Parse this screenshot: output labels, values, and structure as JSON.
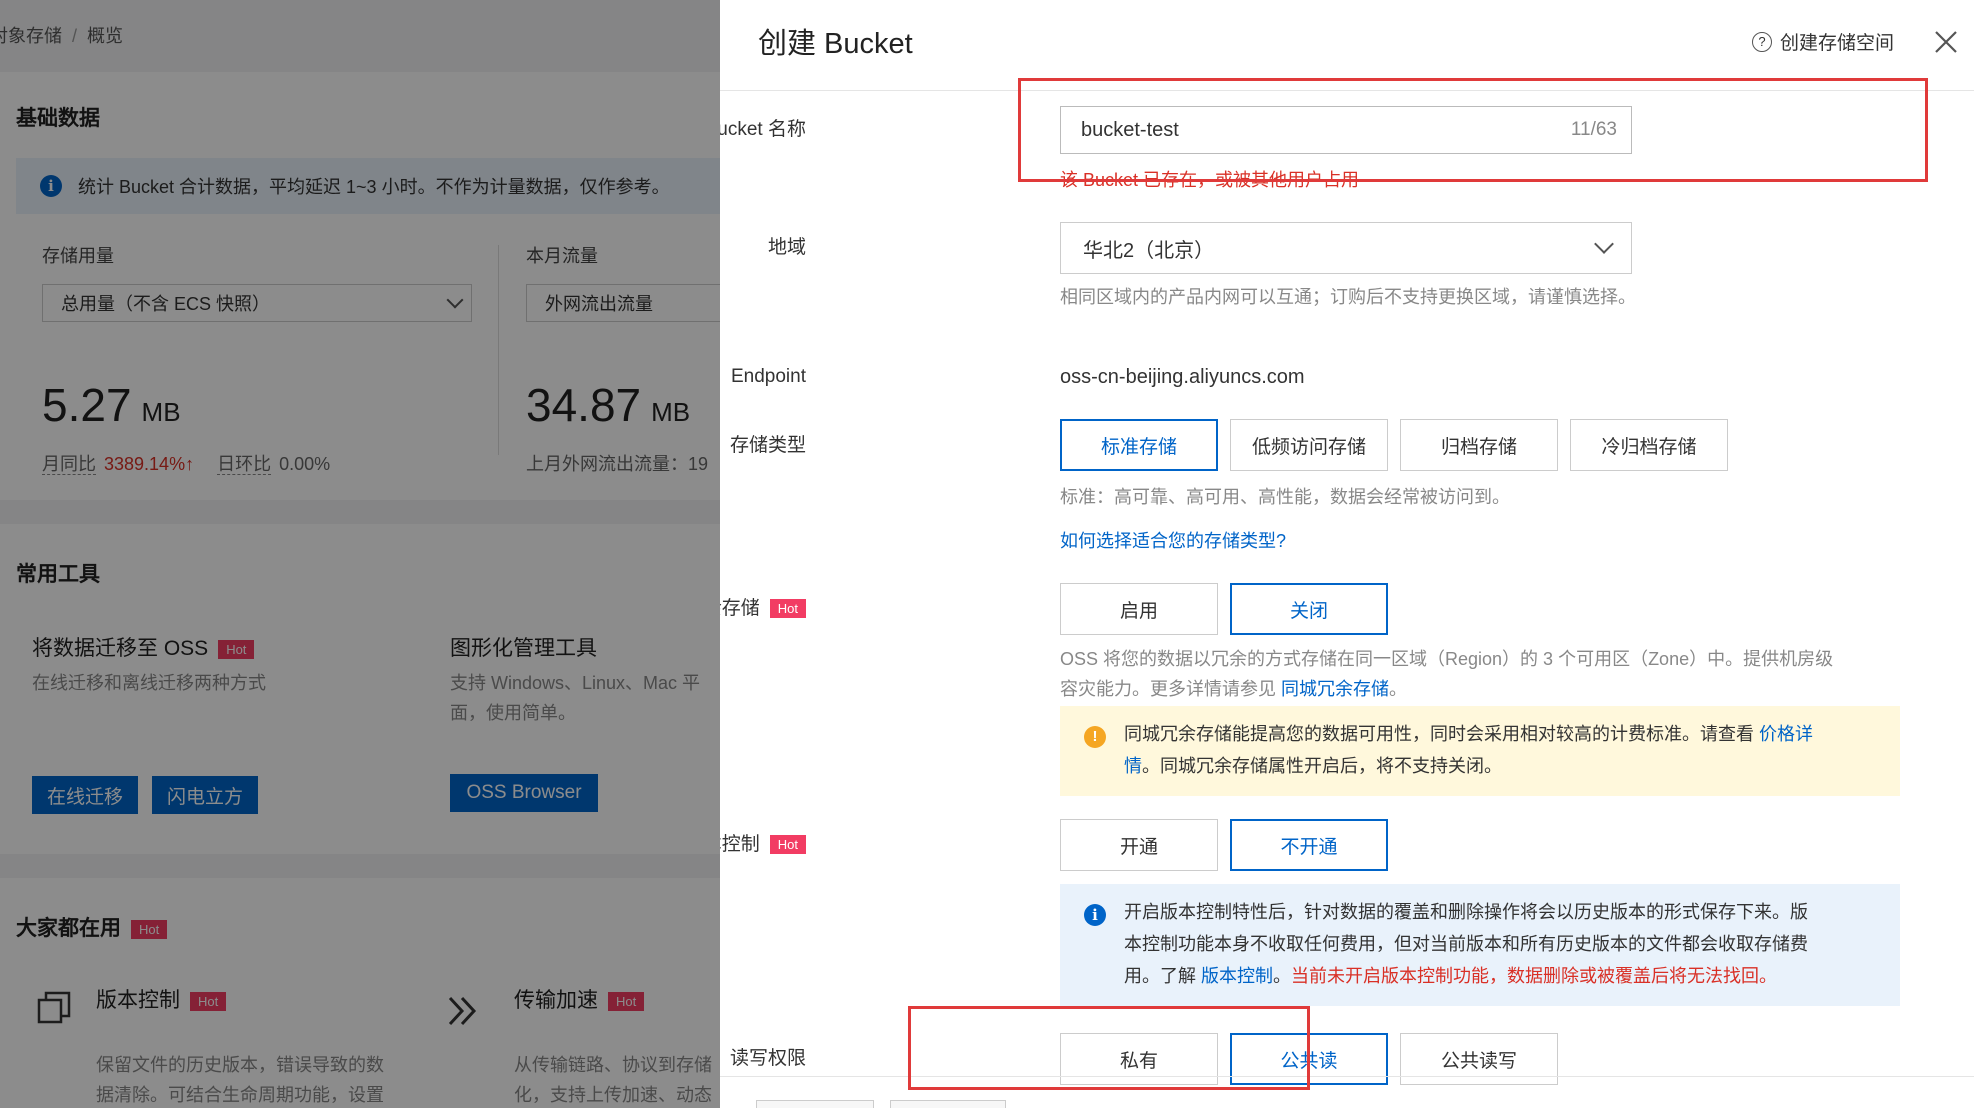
{
  "left": {
    "breadcrumb": [
      "对象存储",
      "概览"
    ],
    "basic": {
      "title": "基础数据",
      "info": "统计 Bucket 合计数据，平均延迟 1~3 小时。不作为计量数据，仅作参考。",
      "storage": {
        "label": "存储用量",
        "select": "总用量（不含 ECS 快照）",
        "value": "5.27",
        "unit": "MB",
        "mom_label": "月同比",
        "mom_value": "3389.14%↑",
        "dod_label": "日环比",
        "dod_value": "0.00%"
      },
      "traffic": {
        "label": "本月流量",
        "select": "外网流出流量",
        "value": "34.87",
        "unit": "MB",
        "last_month": "上月外网流出流量：19"
      }
    },
    "tools": {
      "title": "常用工具",
      "hot": "Hot",
      "migrate": {
        "title": "将数据迁移至 OSS",
        "desc": "在线迁移和离线迁移两种方式",
        "btn_online": "在线迁移",
        "btn_cube": "闪电立方"
      },
      "gui": {
        "title": "图形化管理工具",
        "desc1": "支持 Windows、Linux、Mac 平",
        "desc2": "面，使用简单。",
        "btn": "OSS Browser"
      }
    },
    "popular": {
      "title": "大家都在用",
      "hot": "Hot",
      "versioning": {
        "title": "版本控制",
        "desc1": "保留文件的历史版本，错误导致的数",
        "desc2": "据清除。可结合生命周期功能，设置"
      },
      "accel": {
        "title": "传输加速",
        "desc1": "从传输链路、协议到存储",
        "desc2": "化，支持上传加速、动态"
      }
    }
  },
  "drawer": {
    "title": "创建 Bucket",
    "help": "创建存储空间",
    "name": {
      "label": "Bucket 名称",
      "value": "bucket-test",
      "counter": "11/63",
      "error": "该 Bucket 已存在，或被其他用户占用"
    },
    "region": {
      "label": "地域",
      "value": "华北2（北京）",
      "hint": "相同区域内的产品内网可以互通；订购后不支持更换区域，请谨慎选择。"
    },
    "endpoint": {
      "label": "Endpoint",
      "value": "oss-cn-beijing.aliyuncs.com"
    },
    "storage_class": {
      "label": "存储类型",
      "options": [
        "标准存储",
        "低频访问存储",
        "归档存储",
        "冷归档存储"
      ],
      "selected": "标准存储",
      "hint": "标准：高可靠、高可用、高性能，数据会经常被访问到。",
      "link": "如何选择适合您的存储类型?"
    },
    "zrs": {
      "label": "同城冗余存储",
      "hot": "Hot",
      "options": [
        "启用",
        "关闭"
      ],
      "selected": "关闭",
      "hint1": "OSS 将您的数据以冗余的方式存储在同一区域（Region）的 3 个可用区（Zone）中。提供机房级",
      "hint2": "容灾能力。更多详情请参见 ",
      "hint_link": "同城冗余存储",
      "hint_end": "。",
      "warn1": "同城冗余存储能提高您的数据可用性，同时会采用相对较高的计费标准。请查看 ",
      "warn_link1": "价格详",
      "warn_link2": "情",
      "warn2": "。同城冗余存储属性开启后，将不支持关闭。"
    },
    "versioning": {
      "label": "版本控制",
      "hot": "Hot",
      "options": [
        "开通",
        "不开通"
      ],
      "selected": "不开通",
      "info1": "开启版本控制特性后，针对数据的覆盖和删除操作将会以历史版本的形式保存下来。版",
      "info2": "本控制功能本身不收取任何费用，但对当前版本和所有历史版本的文件都会收取存储费",
      "info3": "用。了解 ",
      "info_link": "版本控制",
      "info_sep": "。",
      "info_red": "当前未开启版本控制功能，数据删除或被覆盖后将无法找回。"
    },
    "acl": {
      "label": "读写权限",
      "options": [
        "私有",
        "公共读",
        "公共读写"
      ],
      "selected": "公共读"
    }
  }
}
